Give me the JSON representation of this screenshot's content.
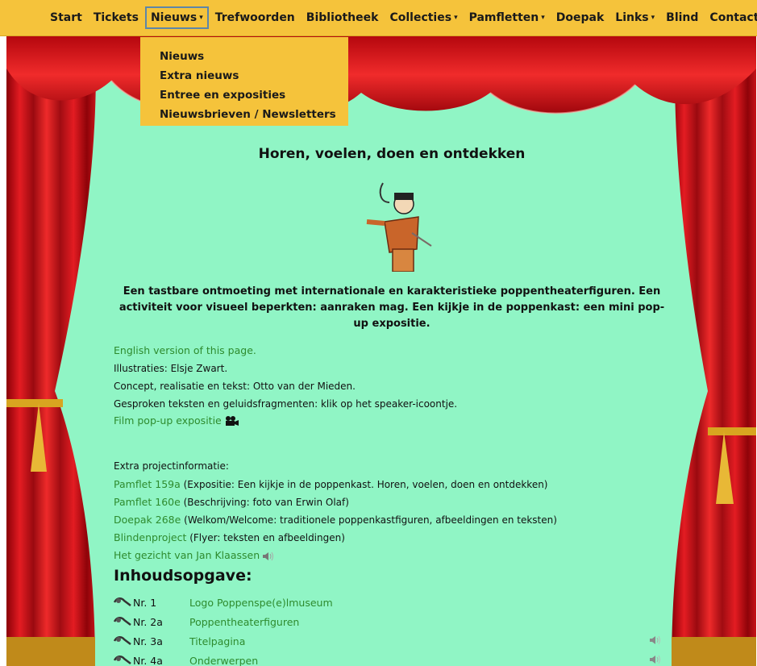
{
  "nav": {
    "items": [
      {
        "label": "Start",
        "caret": ""
      },
      {
        "label": "Tickets",
        "caret": ""
      },
      {
        "label": "Nieuws",
        "caret": "▾"
      },
      {
        "label": "Trefwoorden",
        "caret": ""
      },
      {
        "label": "Bibliotheek",
        "caret": ""
      },
      {
        "label": "Collecties",
        "caret": "▾"
      },
      {
        "label": "Pamfletten",
        "caret": "▾"
      },
      {
        "label": "Doepak",
        "caret": ""
      },
      {
        "label": "Links",
        "caret": "▾"
      },
      {
        "label": "Blind",
        "caret": ""
      },
      {
        "label": "Contact",
        "caret": ""
      }
    ],
    "active_index": 2,
    "dropdown": [
      "Nieuws",
      "Extra nieuws",
      "Entree en exposities",
      "Nieuwsbrieven / Newsletters"
    ]
  },
  "page": {
    "title": "Horen, voelen, doen en ontdekken",
    "intro": "Een tastbare ontmoeting met internationale en karakteristieke poppentheaterfiguren. Een ac­tiviteit voor visueel beperkten: aanraken mag. Een kijkje in de poppenkast: een mini pop-up expositie.",
    "english_link": "English version of this page.",
    "illustrations": "Illustraties: Elsje Zwart.",
    "concept": "Concept, realisatie en tekst: Otto van der Mieden.",
    "spoken": "Gesproken teksten en geluidsfragmenten: klik op het speaker-icoontje.",
    "film_link": "Film pop-up expositie",
    "extra_label": "Extra projectinformatie:",
    "extra": [
      {
        "link": "Pamflet 159a",
        "text": " (Expositie: Een kijkje in de poppenkast. Horen, voelen, doen en ontdekken)"
      },
      {
        "link": "Pamflet 160e",
        "text": " (Beschrijving: foto van Erwin Olaf)"
      },
      {
        "link": "Doepak 268e",
        "text": " (Welkom/Welcome: traditionele poppenkastfiguren, afbeeldingen en teksten)"
      },
      {
        "link": "Blindenproject",
        "text": " (Flyer: teksten en afbeeldingen)"
      }
    ],
    "jan_klaassen_link": "Het gezicht van Jan Klaassen",
    "toc_heading": "Inhoudsopgave:",
    "toc": [
      {
        "nr": "Nr. 1",
        "label": "Logo Poppenspe(e)lmuseum",
        "sound": false
      },
      {
        "nr": "Nr. 2a",
        "label": "Poppentheaterfiguren",
        "sound": false
      },
      {
        "nr": "Nr. 3a",
        "label": "Titelpagina",
        "sound": true
      },
      {
        "nr": "Nr. 4a",
        "label": "Onderwerpen",
        "sound": true
      }
    ]
  },
  "colors": {
    "nav_bg": "#f5c33b",
    "stage_bg": "#90f5c5",
    "link": "#2e8b2e",
    "curtain": "#d4101a"
  },
  "icons": {
    "film": "film-camera-icon",
    "speaker": "speaker-icon",
    "toc": "hand-eye-icon"
  }
}
